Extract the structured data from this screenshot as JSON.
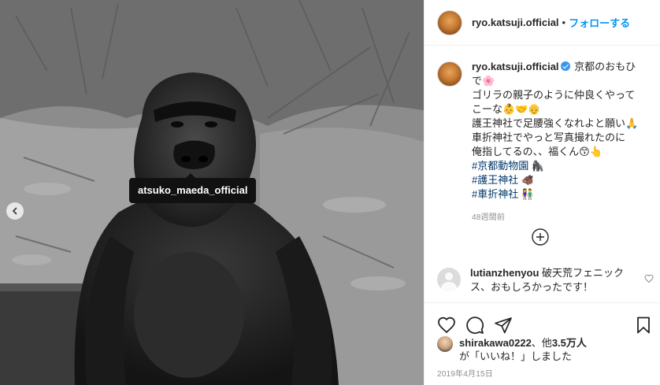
{
  "post": {
    "username": "ryo.katsuji.official",
    "follow_separator": "•",
    "follow_label": "フォローする",
    "tag_label": "atsuko_maeda_official",
    "photo_icon": "chevron-left-icon"
  },
  "caption": {
    "username": "ryo.katsuji.official",
    "lines": [
      "京都のおもひで🌸",
      "ゴリラの親子のように仲良くやってこーな👶🤝👴",
      "護王神社で足腰強くなれよと願い🙏",
      "車折神社でやっと写真撮れたのに",
      "俺指してるの、、福くん😙👆"
    ],
    "hashtags": [
      "#京都動物園 🦍",
      "#護王神社 🐗",
      "#車折神社 👫"
    ],
    "time_ago": "48週間前"
  },
  "comment": {
    "username": "lutianzhenyou",
    "text": "破天荒フェニックス、おもしろかったです！"
  },
  "likes": {
    "prefix_user": "shirakawa0222",
    "middle": "、他",
    "count": "3.5万人",
    "suffix": "が「いいね！」しました"
  },
  "date": "2019年4月15日",
  "icons": {
    "like": "heart-icon",
    "comment": "comment-icon",
    "share": "share-icon",
    "save": "bookmark-icon",
    "load_more": "plus-circle-icon"
  },
  "colors": {
    "link_blue": "#0095f6",
    "hashtag": "#00376b",
    "muted": "#8e8e8e",
    "verified": "#3897f0"
  }
}
